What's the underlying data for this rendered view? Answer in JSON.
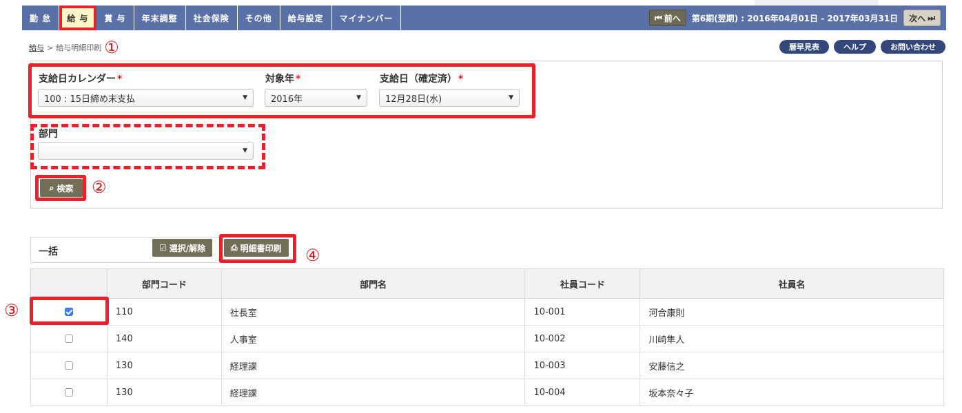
{
  "nav": {
    "tabs": [
      "勤 怠",
      "給 与",
      "賞 与",
      "年末調整",
      "社会保険",
      "その他",
      "給与設定",
      "マイナンバー"
    ],
    "prev_label": "前へ",
    "next_label": "次へ",
    "period_text": "第6期(翌期) : 2016年04月01日 - 2017年03月31日"
  },
  "breadcrumb": {
    "parent": "給与",
    "separator": ">",
    "current": "給与明細印刷"
  },
  "markers": {
    "m1": "①",
    "m2": "②",
    "m3": "③",
    "m4": "④"
  },
  "toplinks": [
    "暦早見表",
    "ヘルプ",
    "お問い合わせ"
  ],
  "form": {
    "calendar_label": "支給日カレンダー",
    "calendar_value": "100 : 15日締め末支払",
    "year_label": "対象年",
    "year_value": "2016年",
    "payday_label": "支給日（確定済）",
    "payday_value": "12月28日(水)",
    "dept_label": "部門",
    "dept_value": "",
    "required_mark": "*",
    "search_label": "検索"
  },
  "bulk": {
    "label": "一括",
    "toggle_label": "選択/解除",
    "print_label": "明細書印刷"
  },
  "table": {
    "headers": [
      "",
      "部門コード",
      "部門名",
      "社員コード",
      "社員名"
    ],
    "rows": [
      {
        "checked": true,
        "dept_code": "110",
        "dept_name": "社長室",
        "emp_code": "10-001",
        "emp_name": "河合康則"
      },
      {
        "checked": false,
        "dept_code": "140",
        "dept_name": "人事室",
        "emp_code": "10-002",
        "emp_name": "川崎隼人"
      },
      {
        "checked": false,
        "dept_code": "130",
        "dept_name": "経理課",
        "emp_code": "10-003",
        "emp_name": "安藤信之"
      },
      {
        "checked": false,
        "dept_code": "130",
        "dept_name": "経理課",
        "emp_code": "10-004",
        "emp_name": "坂本奈々子"
      }
    ]
  },
  "colors": {
    "nav": "#5a71a8",
    "accent_red": "#e8202a",
    "button": "#726f58",
    "pill": "#34477a"
  }
}
